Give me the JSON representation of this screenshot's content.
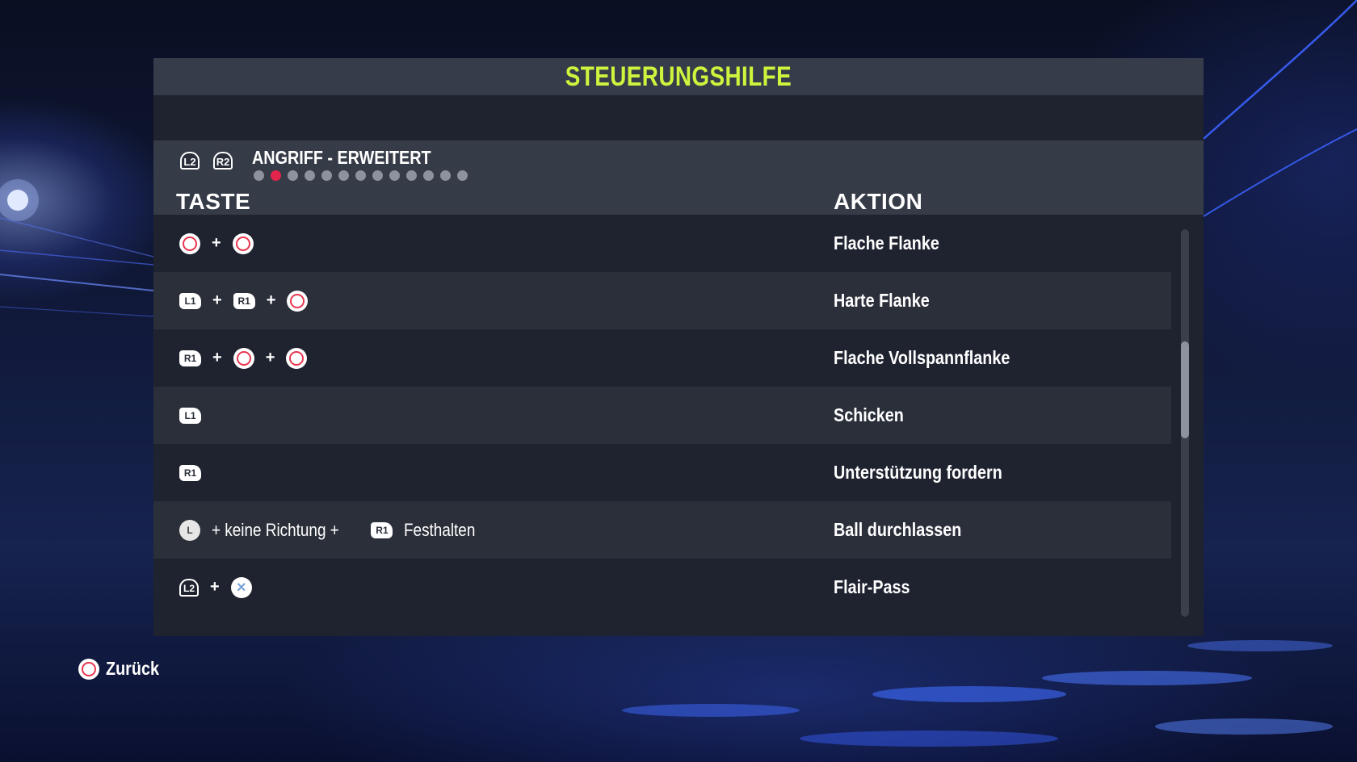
{
  "title": "STEUERUNGSHILFE",
  "category": {
    "trigger_left": "L2",
    "trigger_right": "R2",
    "title": "ANGRIFF - ERWEITERT",
    "pages_total": 13,
    "active_page": 2
  },
  "columns": {
    "taste": "TASTE",
    "aktion": "AKTION"
  },
  "rows": [
    {
      "keys": [
        {
          "t": "circle"
        },
        {
          "t": "plus"
        },
        {
          "t": "circle"
        }
      ],
      "action": "Flache Flanke"
    },
    {
      "keys": [
        {
          "t": "bumper",
          "label": "L1"
        },
        {
          "t": "plus"
        },
        {
          "t": "bumper",
          "label": "R1"
        },
        {
          "t": "plus"
        },
        {
          "t": "circle"
        }
      ],
      "action": "Harte Flanke"
    },
    {
      "keys": [
        {
          "t": "bumper",
          "label": "R1"
        },
        {
          "t": "plus"
        },
        {
          "t": "circle"
        },
        {
          "t": "plus"
        },
        {
          "t": "circle"
        }
      ],
      "action": "Flache Vollspannflanke"
    },
    {
      "keys": [
        {
          "t": "bumper",
          "label": "L1"
        }
      ],
      "action": "Schicken"
    },
    {
      "keys": [
        {
          "t": "bumper",
          "label": "R1"
        }
      ],
      "action": "Unterstützung fordern"
    },
    {
      "keys": [
        {
          "t": "stick",
          "label": "L"
        },
        {
          "t": "text",
          "label": "+ keine Richtung +"
        },
        {
          "t": "bumper",
          "label": "R1"
        },
        {
          "t": "text",
          "label": "Festhalten"
        }
      ],
      "action": "Ball durchlassen"
    },
    {
      "keys": [
        {
          "t": "trigger",
          "label": "L2"
        },
        {
          "t": "plus"
        },
        {
          "t": "cross"
        }
      ],
      "action": "Flair-Pass"
    }
  ],
  "scroll": {
    "thumb_fraction_start": 0.29,
    "thumb_fraction_size": 0.25
  },
  "footer": {
    "back_icon": "circle-button-icon",
    "back_label": "Zurück"
  },
  "colors": {
    "title": "#cdf53d",
    "active_dot": "#e3244c",
    "circle_button": "#e8364f"
  }
}
